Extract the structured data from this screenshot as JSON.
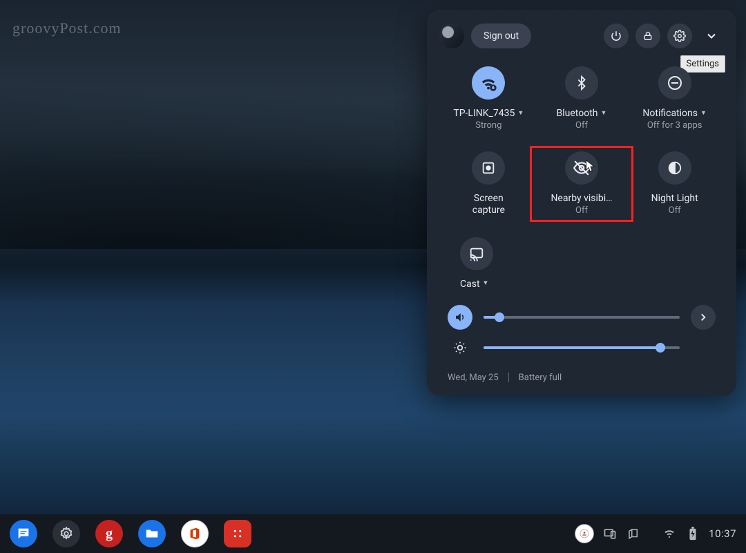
{
  "watermark": "groovyPost.com",
  "header": {
    "signout_label": "Sign out",
    "tooltip": "Settings"
  },
  "tiles": {
    "wifi": {
      "label": "TP-LINK_7435",
      "sub": "Strong"
    },
    "bluetooth": {
      "label": "Bluetooth",
      "sub": "Off"
    },
    "notifications": {
      "label": "Notifications",
      "sub": "Off for 3 apps"
    },
    "capture": {
      "label": "Screen capture"
    },
    "nearby": {
      "label": "Nearby visibi…",
      "sub": "Off"
    },
    "nightlight": {
      "label": "Night Light",
      "sub": "Off"
    },
    "cast": {
      "label": "Cast"
    }
  },
  "sliders": {
    "volume_pct": 8,
    "brightness_pct": 90
  },
  "status": {
    "date": "Wed, May 25",
    "battery": "Battery full"
  },
  "shelf": {
    "time": "10:37"
  }
}
